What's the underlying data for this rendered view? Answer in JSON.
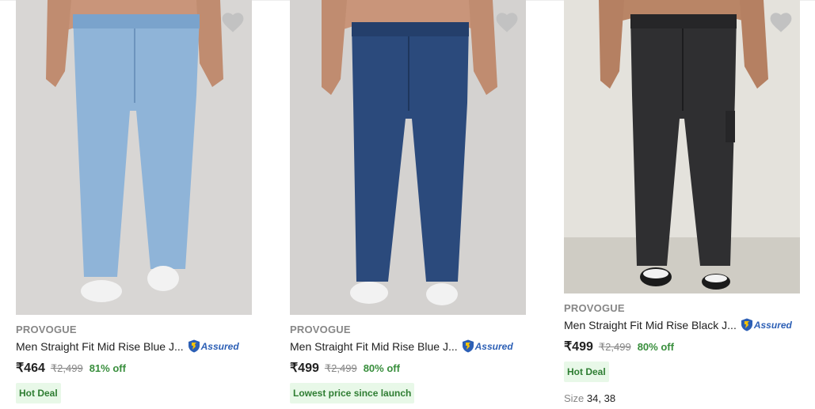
{
  "products": [
    {
      "brand": "PROVOGUE",
      "title": "Men Straight Fit Mid Rise Blue J...",
      "assured_label": "Assured",
      "price": "₹464",
      "mrp": "₹2,499",
      "discount": "81% off",
      "badge": "Hot Deal",
      "denim_color": "#8fb4d8",
      "wishlist_icon": "heart-icon"
    },
    {
      "brand": "PROVOGUE",
      "title": "Men Straight Fit Mid Rise Blue J...",
      "assured_label": "Assured",
      "price": "₹499",
      "mrp": "₹2,499",
      "discount": "80% off",
      "badge": "Lowest price since launch",
      "denim_color": "#2b4a7c",
      "wishlist_icon": "heart-icon"
    },
    {
      "brand": "PROVOGUE",
      "title": "Men Straight Fit Mid Rise Black J...",
      "assured_label": "Assured",
      "price": "₹499",
      "mrp": "₹2,499",
      "discount": "80% off",
      "badge": "Hot Deal",
      "size_label": "Size",
      "size_values": "34, 38",
      "denim_color": "#2f2f31",
      "wishlist_icon": "heart-icon"
    }
  ],
  "colors": {
    "discount_green": "#388e3c",
    "badge_bg": "#e8f8e8",
    "assured_blue": "#2c5fb5"
  }
}
